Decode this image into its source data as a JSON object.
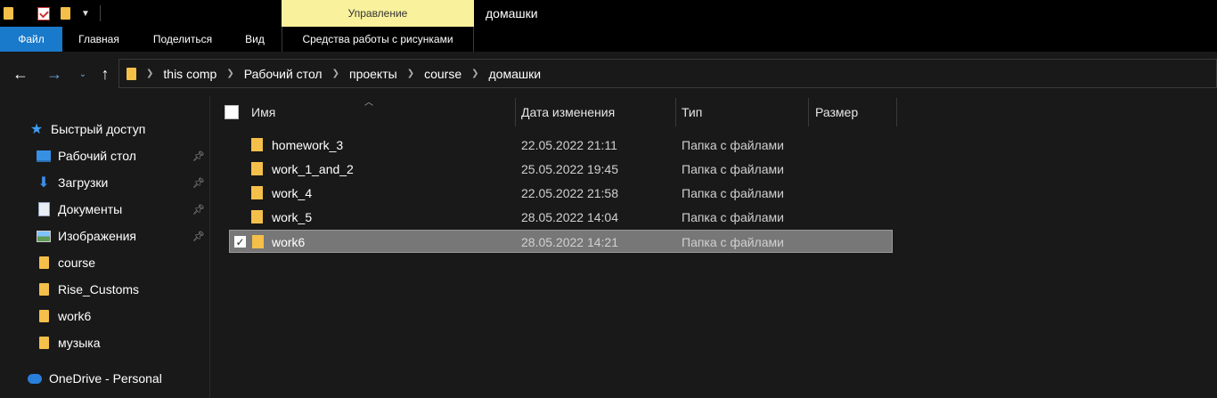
{
  "window": {
    "title": "домашки",
    "context_tab": "Управление"
  },
  "ribbon": {
    "tabs": [
      "Файл",
      "Главная",
      "Поделиться",
      "Вид"
    ],
    "context_tab_label": "Средства работы с рисунками"
  },
  "address": {
    "crumbs": [
      "this comp",
      "Рабочий стол",
      "проекты",
      "course",
      "домашки"
    ]
  },
  "sidebar": {
    "quick_access": "Быстрый доступ",
    "items": [
      {
        "label": "Рабочий стол",
        "icon": "desktop-icon",
        "pinned": true
      },
      {
        "label": "Загрузки",
        "icon": "download-icon",
        "pinned": true
      },
      {
        "label": "Документы",
        "icon": "documents-icon",
        "pinned": true
      },
      {
        "label": "Изображения",
        "icon": "pictures-icon",
        "pinned": true
      },
      {
        "label": "course",
        "icon": "folder-icon",
        "pinned": false
      },
      {
        "label": "Rise_Customs",
        "icon": "folder-icon",
        "pinned": false
      },
      {
        "label": "work6",
        "icon": "folder-icon",
        "pinned": false
      },
      {
        "label": "музыка",
        "icon": "folder-icon",
        "pinned": false
      }
    ],
    "onedrive": "OneDrive - Personal"
  },
  "columns": {
    "name": "Имя",
    "date": "Дата изменения",
    "type": "Тип",
    "size": "Размер"
  },
  "files": [
    {
      "name": "homework_3",
      "date": "22.05.2022 21:11",
      "type": "Папка с файлами",
      "selected": false
    },
    {
      "name": "work_1_and_2",
      "date": "25.05.2022 19:45",
      "type": "Папка с файлами",
      "selected": false
    },
    {
      "name": "work_4",
      "date": "22.05.2022 21:58",
      "type": "Папка с файлами",
      "selected": false
    },
    {
      "name": "work_5",
      "date": "28.05.2022 14:04",
      "type": "Папка с файлами",
      "selected": false
    },
    {
      "name": "work6",
      "date": "28.05.2022 14:21",
      "type": "Папка с файлами",
      "selected": true
    }
  ],
  "colors": {
    "accent": "#1979ca",
    "context_tab": "#f9f19b",
    "folder": "#f4c04a",
    "selection": "#777777"
  }
}
